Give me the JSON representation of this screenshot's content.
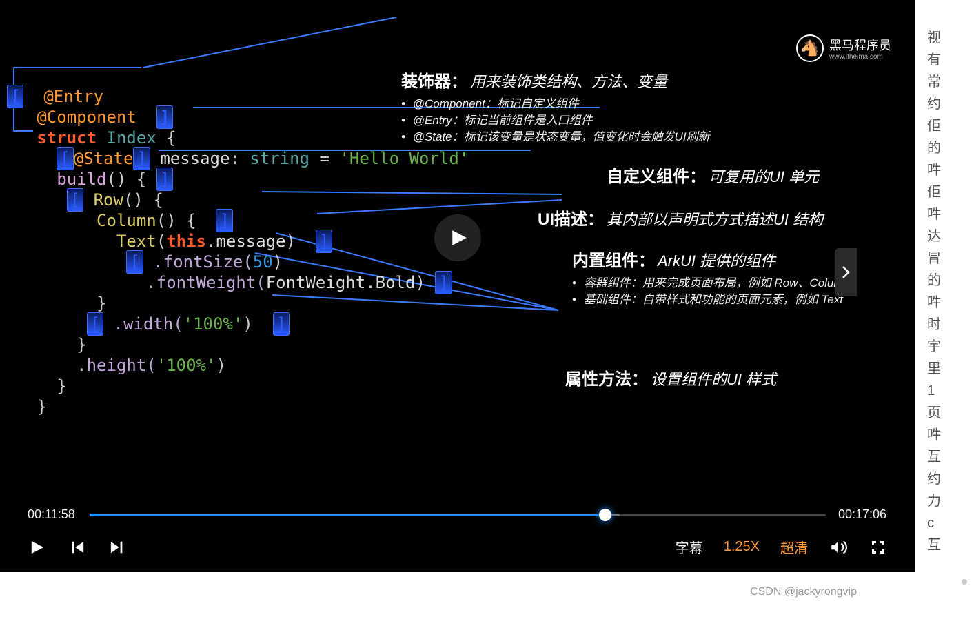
{
  "logo": {
    "name": "黑马程序员",
    "sub": "www.itheima.com"
  },
  "code": {
    "entry": "@Entry",
    "component": "@Component",
    "struct": "struct",
    "idx": "Index",
    "lb": "{",
    "state": "@State",
    "msg": "message",
    "colon": ":",
    "string": "string",
    "eq": "=",
    "hello": "'Hello World'",
    "build": "build",
    "paren": "()",
    "lb2": "{",
    "row": "Row",
    "col": "Column",
    "text": "Text",
    "this": "this",
    "dot": ".",
    "msgp": "message",
    "fontSize": ".fontSize(",
    "fifty": "50",
    "rp": ")",
    "fontWeight": ".fontWeight(",
    "fw": "FontWeight",
    "bold": "Bold",
    "width": ".width(",
    "h100": "'100%'",
    "height": ".height(",
    "rb": "}"
  },
  "annotations": {
    "dec": {
      "title": "装饰器：",
      "desc": "用来装饰类结构、方法、变量",
      "bullets": [
        "@Component：标记自定义组件",
        "@Entry：标记当前组件是入口组件",
        "@State：标记该变量是状态变量，值变化时会触发UI刷新"
      ]
    },
    "custom": {
      "title": "自定义组件：",
      "desc": "可复用的UI 单元"
    },
    "uidesc": {
      "title": "UI描述：",
      "desc": "其内部以声明式方式描述UI 结构"
    },
    "builtin": {
      "title": "内置组件：",
      "desc": "ArkUI 提供的组件",
      "bullets": [
        "容器组件：用来完成页面布局，例如 Row、Column",
        "基础组件：自带样式和功能的页面元素，例如 Text"
      ]
    },
    "attr": {
      "title": "属性方法：",
      "desc": "设置组件的UI 样式"
    }
  },
  "controls": {
    "cur": "00:11:58",
    "dur": "00:17:06",
    "progress": 70,
    "buffer": 72,
    "subtitle": "字幕",
    "speed": "1.25X",
    "quality": "超清"
  },
  "sidebar": [
    "视",
    "有",
    "常",
    "约",
    "佢",
    "的",
    "吽",
    "佢",
    "吽",
    "达",
    "冒",
    "的",
    "吽",
    "时",
    "宇",
    "里",
    "1",
    "页",
    "吽",
    "互",
    "约",
    "力",
    "c",
    "互"
  ],
  "watermark": "CSDN @jackyrongvip"
}
